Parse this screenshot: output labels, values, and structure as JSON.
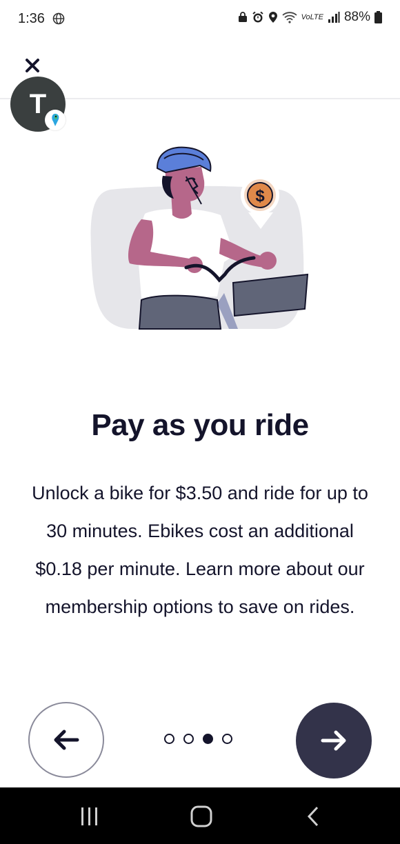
{
  "status_bar": {
    "time": "1:36",
    "battery": "88%",
    "network": "VoLTE"
  },
  "avatar": {
    "letter": "T"
  },
  "onboarding": {
    "title": "Pay as you ride",
    "body": "Unlock a bike for $3.50 and ride for up to 30 minutes. Ebikes cost an additional $0.18 per minute. Learn more about our membership options to save on rides.",
    "dollar_symbol": "$",
    "current_page": 3,
    "total_pages": 4
  },
  "colors": {
    "title": "#14142b",
    "next_button": "#33334a",
    "coin": "#e0894a",
    "helmet": "#5b7fd9",
    "skin": "#b6678a"
  }
}
